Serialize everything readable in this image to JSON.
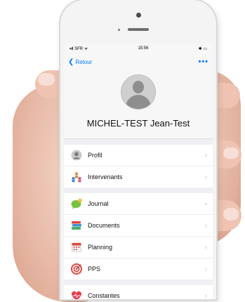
{
  "status": {
    "carrier": "SFR",
    "time": "15:56"
  },
  "nav": {
    "back_label": "Retour",
    "more_label": "•••"
  },
  "profile": {
    "name": "MICHEL-TEST Jean-Test"
  },
  "menu": {
    "group1": [
      {
        "label": "Profil",
        "icon": "profile-icon"
      },
      {
        "label": "Intervenants",
        "icon": "people-icon"
      }
    ],
    "group2": [
      {
        "label": "Journal",
        "icon": "chat-icon"
      },
      {
        "label": "Documents",
        "icon": "books-icon"
      },
      {
        "label": "Planning",
        "icon": "calendar-icon"
      },
      {
        "label": "PPS",
        "icon": "target-icon"
      }
    ],
    "group3": [
      {
        "label": "Constantes",
        "icon": "heart-icon"
      }
    ]
  },
  "colors": {
    "accent": "#007aff",
    "background": "#efeff4"
  }
}
